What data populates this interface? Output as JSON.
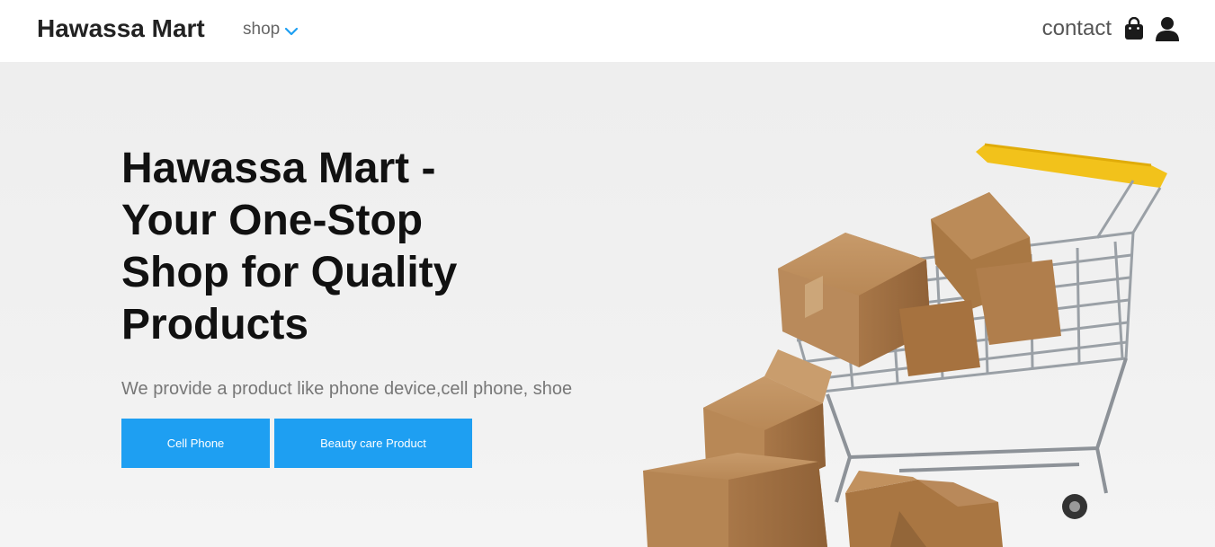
{
  "nav": {
    "brand": "Hawassa Mart",
    "shop_label": "shop",
    "contact_label": "contact",
    "accent": "#1e9ff2"
  },
  "icons": {
    "shop_dropdown": "chevron-down-icon",
    "cart": "shopping-bag-icon",
    "account": "user-icon"
  },
  "hero": {
    "title": "Hawassa Mart - Your One-Stop Shop for Quality Products",
    "subtitle": "We provide a product like phone device,cell phone, shoe",
    "buttons": {
      "cell_phone": "Cell Phone",
      "beauty_care": "Beauty care Product"
    },
    "button_color": "#1e9ff2"
  }
}
